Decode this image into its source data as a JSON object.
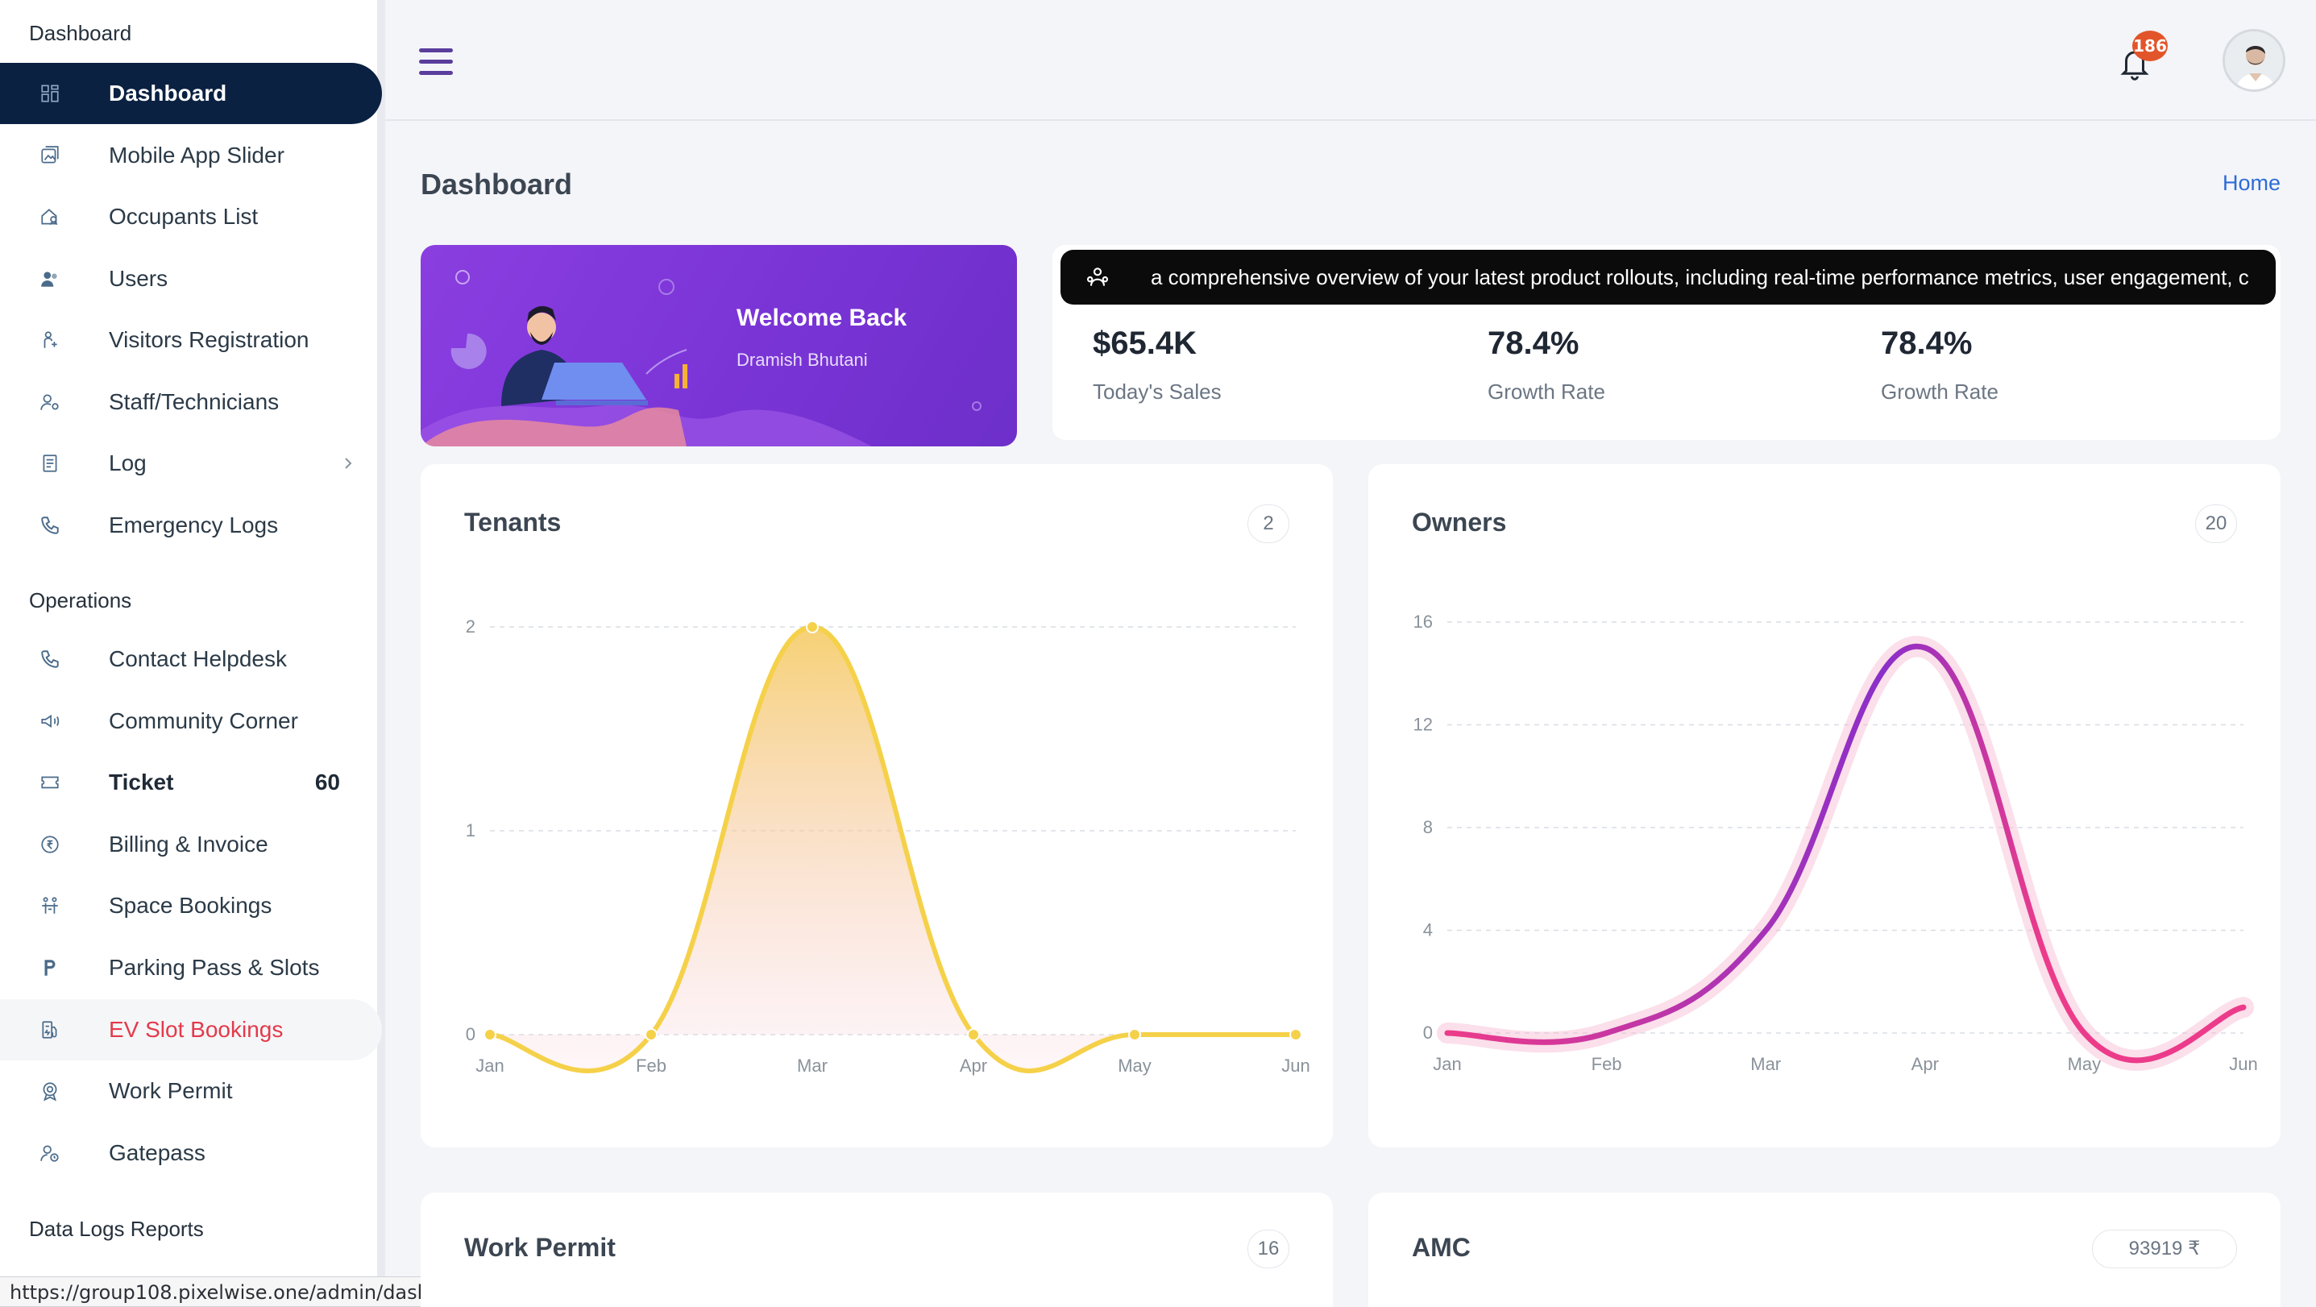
{
  "sidebar": {
    "section1_title": "Dashboard",
    "section2_title": "Operations",
    "section3_title": "Data Logs Reports",
    "items": [
      {
        "label": "Dashboard",
        "icon": "grid-icon"
      },
      {
        "label": "Mobile App Slider",
        "icon": "images-icon"
      },
      {
        "label": "Occupants List",
        "icon": "home-user-icon"
      },
      {
        "label": "Users",
        "icon": "users-icon"
      },
      {
        "label": "Visitors Registration",
        "icon": "visitor-icon"
      },
      {
        "label": "Staff/Technicians",
        "icon": "staff-icon"
      },
      {
        "label": "Log",
        "icon": "log-icon"
      },
      {
        "label": "Emergency Logs",
        "icon": "phone-icon"
      },
      {
        "label": "Contact Helpdesk",
        "icon": "phone-icon"
      },
      {
        "label": "Community Corner",
        "icon": "megaphone-icon"
      },
      {
        "label": "Ticket",
        "icon": "ticket-icon",
        "count": "60"
      },
      {
        "label": "Billing & Invoice",
        "icon": "rupee-icon"
      },
      {
        "label": "Space Bookings",
        "icon": "space-icon"
      },
      {
        "label": "Parking Pass & Slots",
        "icon": "parking-icon"
      },
      {
        "label": "EV Slot Bookings",
        "icon": "ev-icon"
      },
      {
        "label": "Work Permit",
        "icon": "badge-icon"
      },
      {
        "label": "Gatepass",
        "icon": "gatepass-icon"
      }
    ]
  },
  "status_url": "https://group108.pixelwise.one/admin/dashboard#",
  "header": {
    "notifications_count": "186"
  },
  "page": {
    "title": "Dashboard",
    "breadcrumb": "Home"
  },
  "welcome": {
    "title": "Welcome Back",
    "name": "Dramish Bhutani"
  },
  "ticker": {
    "text": "a comprehensive overview of your latest product rollouts, including real-time performance metrics, user engagement, c"
  },
  "stats": [
    {
      "value": "$65.4K",
      "label": "Today's Sales"
    },
    {
      "value": "78.4%",
      "label": "Growth Rate"
    },
    {
      "value": "78.4%",
      "label": "Growth Rate"
    }
  ],
  "cards": {
    "tenants": {
      "title": "Tenants",
      "count": "2"
    },
    "owners": {
      "title": "Owners",
      "count": "20"
    },
    "work_permit": {
      "title": "Work Permit",
      "count": "16"
    },
    "amc": {
      "title": "AMC",
      "count": "93919 ₹"
    }
  },
  "chart_data": [
    {
      "type": "area",
      "title": "Tenants",
      "categories": [
        "Jan",
        "Feb",
        "Mar",
        "Apr",
        "May",
        "Jun"
      ],
      "series": [
        {
          "values": [
            0,
            0,
            2,
            0,
            0,
            0
          ]
        }
      ],
      "yticks": [
        0,
        1,
        2
      ],
      "ylim": [
        0,
        2
      ],
      "grid": true,
      "color": "#f5d14a"
    },
    {
      "type": "line",
      "title": "Owners",
      "categories": [
        "Jan",
        "Feb",
        "Mar",
        "Apr",
        "May",
        "Jun"
      ],
      "series": [
        {
          "values": [
            0,
            0,
            4,
            15,
            0,
            1
          ]
        }
      ],
      "yticks": [
        0,
        4,
        8,
        12,
        16
      ],
      "ylim": [
        0,
        16
      ],
      "grid": true,
      "color_start": "#8b2fc9",
      "color_end": "#ec3b8a"
    }
  ]
}
